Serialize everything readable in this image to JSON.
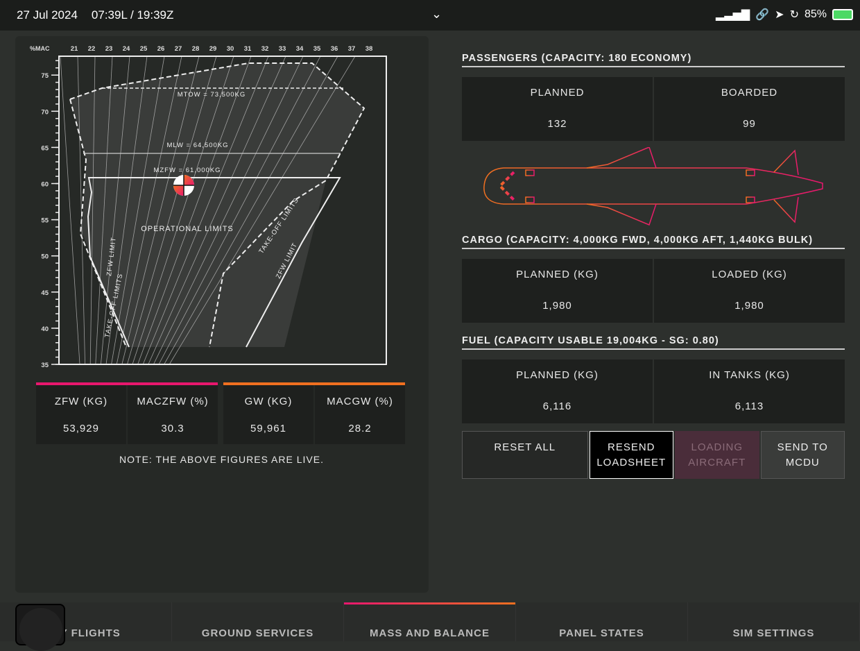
{
  "status": {
    "date": "27 Jul 2024",
    "time": "07:39L / 19:39Z",
    "battery": "85%",
    "icons": [
      "signal-icon",
      "link-icon",
      "location-icon",
      "rotation-lock-icon",
      "battery-icon"
    ]
  },
  "chart": {
    "x_axis_label": "%MAC",
    "x_ticks": [
      "21",
      "22",
      "23",
      "24",
      "25",
      "26",
      "27",
      "28",
      "29",
      "30",
      "31",
      "32",
      "33",
      "34",
      "35",
      "36",
      "37",
      "38"
    ],
    "y_ticks": [
      "75",
      "70",
      "65",
      "60",
      "55",
      "50",
      "45",
      "40",
      "35"
    ],
    "labels": {
      "mtow": "MTOW = 73,500KG",
      "mlw": "MLW = 64,500KG",
      "mzfw": "MZFW = 61,000KG",
      "operational": "OPERATIONAL LIMITS",
      "zfw_left": "ZFW LIMIT",
      "to_left": "TAKE-OFF LIMITS",
      "to_right": "TAKE-OFF LIMITS",
      "zfw_right": "ZFW LIMIT"
    },
    "cg_marker": {
      "weight_t": 60,
      "mac": 27.3
    }
  },
  "stats": {
    "zfw_label": "ZFW (KG)",
    "zfw": "53,929",
    "maczfw_label": "MACZFW (%)",
    "maczfw": "30.3",
    "gw_label": "GW (KG)",
    "gw": "59,961",
    "macgw_label": "MACGW (%)",
    "macgw": "28.2",
    "note": "NOTE: THE ABOVE FIGURES ARE LIVE.",
    "zfw_color": "#e8176e",
    "gw_color": "#f07020"
  },
  "passengers": {
    "title": "PASSENGERS (CAPACITY: 180 ECONOMY)",
    "planned_label": "PLANNED",
    "planned": "132",
    "boarded_label": "BOARDED",
    "boarded": "99"
  },
  "cargo": {
    "title": "CARGO (CAPACITY: 4,000KG FWD, 4,000KG AFT, 1,440KG BULK)",
    "planned_label": "PLANNED (KG)",
    "planned": "1,980",
    "loaded_label": "LOADED (KG)",
    "loaded": "1,980"
  },
  "fuel": {
    "title": "FUEL (CAPACITY USABLE 19,004KG - SG: 0.80)",
    "planned_label": "PLANNED (KG)",
    "planned": "6,116",
    "tanks_label": "IN TANKS (KG)",
    "tanks": "6,113"
  },
  "buttons": {
    "reset": "RESET ALL",
    "resend": "RESEND LOADSHEET",
    "loading": "LOADING AIRCRAFT",
    "send": "SEND TO MCDU"
  },
  "tabs": [
    "MY FLIGHTS",
    "GROUND SERVICES",
    "MASS AND BALANCE",
    "PANEL STATES",
    "SIM SETTINGS"
  ],
  "active_tab": "MASS AND BALANCE"
}
